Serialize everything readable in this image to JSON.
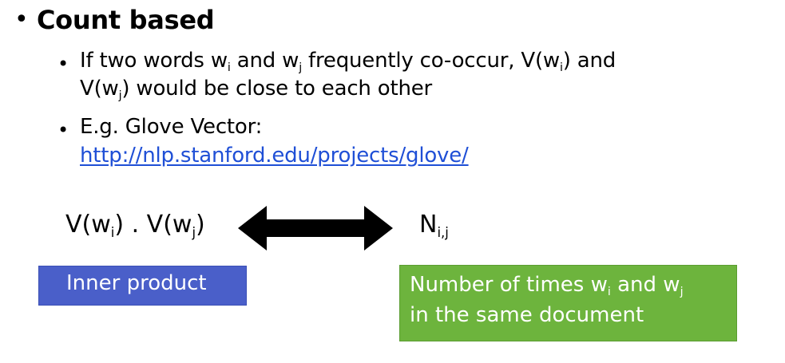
{
  "heading": "Count based",
  "bullets": {
    "b1_part1": "If two words w",
    "b1_sub1": "i",
    "b1_part2": " and w",
    "b1_sub2": "j",
    "b1_part3": " frequently co-occur, V(w",
    "b1_sub3": "i",
    "b1_part4": ") and",
    "b1_line2_part1": "V(w",
    "b1_line2_sub": "j",
    "b1_line2_part2": ") would be close to each other",
    "b2_text": "E.g. Glove Vector:",
    "b2_link": "http://nlp.stanford.edu/projects/glove/"
  },
  "formula": {
    "left_a": "V(w",
    "left_sub_a": "i",
    "left_b": ") . V(w",
    "left_sub_b": "j",
    "left_c": ")",
    "right_main": "N",
    "right_sub": "i,j"
  },
  "boxes": {
    "inner_product": "Inner product",
    "green_line1_a": "Number of times w",
    "green_line1_sub1": "i",
    "green_line1_b": " and w",
    "green_line1_sub2": "j",
    "green_line2": "in the same document"
  },
  "colors": {
    "link": "#1f4fd6",
    "blue_box": "#4a5fc9",
    "green_box": "#6db43d"
  }
}
